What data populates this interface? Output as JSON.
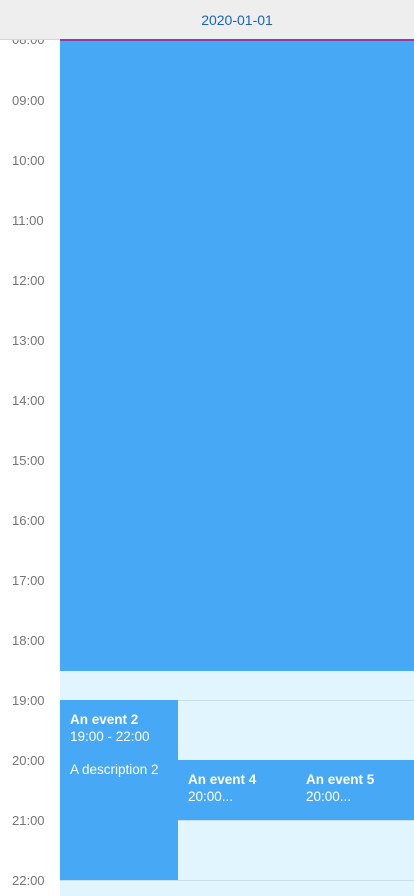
{
  "header": {
    "date": "2020-01-01"
  },
  "hours": [
    "08:00",
    "09:00",
    "10:00",
    "11:00",
    "12:00",
    "13:00",
    "14:00",
    "15:00",
    "16:00",
    "17:00",
    "18:00",
    "19:00",
    "20:00",
    "21:00",
    "22:00"
  ],
  "events": {
    "event1": {
      "title": "",
      "time": ""
    },
    "event2": {
      "title": "An event 2",
      "time": "19:00 - 22:00",
      "description": "A description 2"
    },
    "event4": {
      "title": "An event 4",
      "time": "20:00..."
    },
    "event5": {
      "title": "An event 5",
      "time": "20:00..."
    }
  },
  "colors": {
    "event": "#47a9f5",
    "background": "#e1f5fe",
    "header_date": "#1565c0",
    "now_line": "#8e3ea8"
  }
}
